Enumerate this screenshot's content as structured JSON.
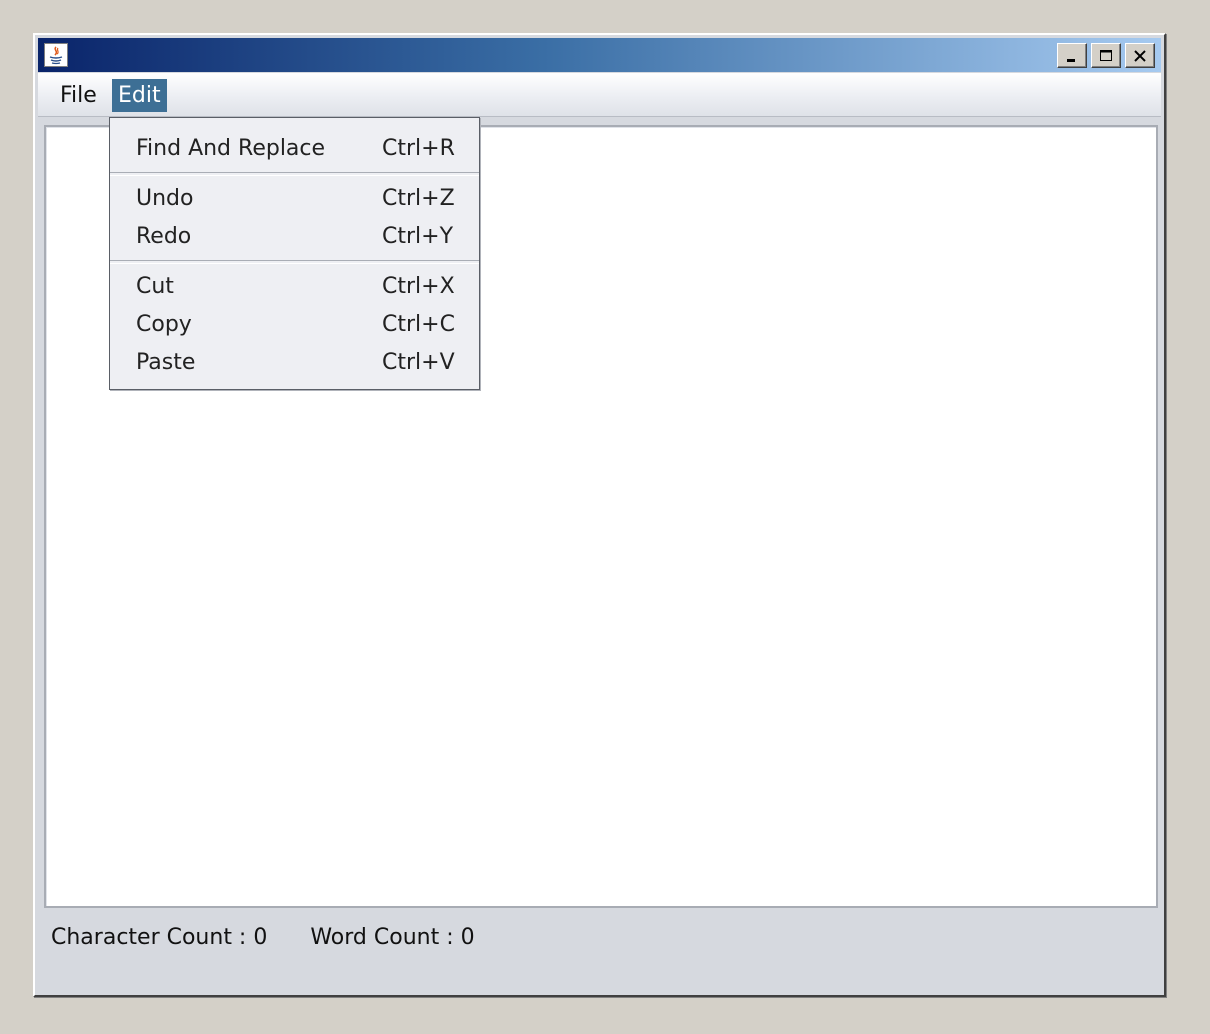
{
  "window": {
    "title": "",
    "controls": {
      "minimize_icon": "minimize-icon",
      "maximize_icon": "maximize-icon",
      "close_icon": "close-icon"
    },
    "app_icon": "java-icon"
  },
  "menubar": {
    "items": [
      {
        "label": "File",
        "selected": false
      },
      {
        "label": "Edit",
        "selected": true
      }
    ],
    "selected_color": "#3d6f95"
  },
  "edit_menu": {
    "groups": [
      [
        {
          "label": "Find And Replace",
          "shortcut": "Ctrl+R"
        }
      ],
      [
        {
          "label": "Undo",
          "shortcut": "Ctrl+Z"
        },
        {
          "label": "Redo",
          "shortcut": "Ctrl+Y"
        }
      ],
      [
        {
          "label": "Cut",
          "shortcut": "Ctrl+X"
        },
        {
          "label": "Copy",
          "shortcut": "Ctrl+C"
        },
        {
          "label": "Paste",
          "shortcut": "Ctrl+V"
        }
      ]
    ]
  },
  "editor": {
    "text": ""
  },
  "status": {
    "character_count": "Character Count :  0",
    "word_count": "Word Count :  0"
  },
  "colors": {
    "titlebar_start": "#0a246a",
    "titlebar_end": "#a6caf0",
    "desktop": "#d4d0c8"
  }
}
